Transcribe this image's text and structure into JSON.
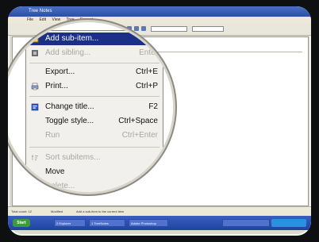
{
  "window": {
    "title": "Tree Notes"
  },
  "menu_bar": [
    "File",
    "Edit",
    "View",
    "Tree",
    "Format"
  ],
  "status_bar": {
    "left": "Total count: 12",
    "middle": "Modified",
    "right": "Add a sub-item to the current item"
  },
  "taskbar": {
    "start_label": "Start",
    "items": [
      "2 Explorer",
      "1 TreeNotes",
      "Adobe Photoshop"
    ]
  },
  "context_menu": {
    "items": [
      {
        "label": "Add sub-item...",
        "shortcut": "",
        "disabled": false,
        "highlighted": true,
        "icon": "add-sub-item-icon"
      },
      {
        "label": "Add sibling...",
        "shortcut": "Enter",
        "disabled": true,
        "highlighted": false,
        "icon": "add-sibling-icon"
      },
      {
        "label": "Export...",
        "shortcut": "Ctrl+E",
        "disabled": false,
        "highlighted": false,
        "icon": ""
      },
      {
        "label": "Print...",
        "shortcut": "Ctrl+P",
        "disabled": false,
        "highlighted": false,
        "icon": "printer-icon"
      },
      {
        "label": "Change title...",
        "shortcut": "F2",
        "disabled": false,
        "highlighted": false,
        "icon": "change-title-icon"
      },
      {
        "label": "Toggle style...",
        "shortcut": "Ctrl+Space",
        "disabled": false,
        "highlighted": false,
        "icon": ""
      },
      {
        "label": "Run",
        "shortcut": "Ctrl+Enter",
        "disabled": true,
        "highlighted": false,
        "icon": ""
      },
      {
        "label": "Sort subitems...",
        "shortcut": "",
        "disabled": true,
        "highlighted": false,
        "icon": "sort-icon"
      },
      {
        "label": "Move",
        "shortcut": "",
        "disabled": false,
        "highlighted": false,
        "icon": ""
      },
      {
        "label": "Delete...",
        "shortcut": "",
        "disabled": true,
        "highlighted": false,
        "icon": ""
      }
    ]
  },
  "colors": {
    "highlight": "#1b2f86",
    "disabled_text": "#a8a7a2",
    "taskbar": "#2a4fb0",
    "start_button": "#3d9a3d"
  }
}
